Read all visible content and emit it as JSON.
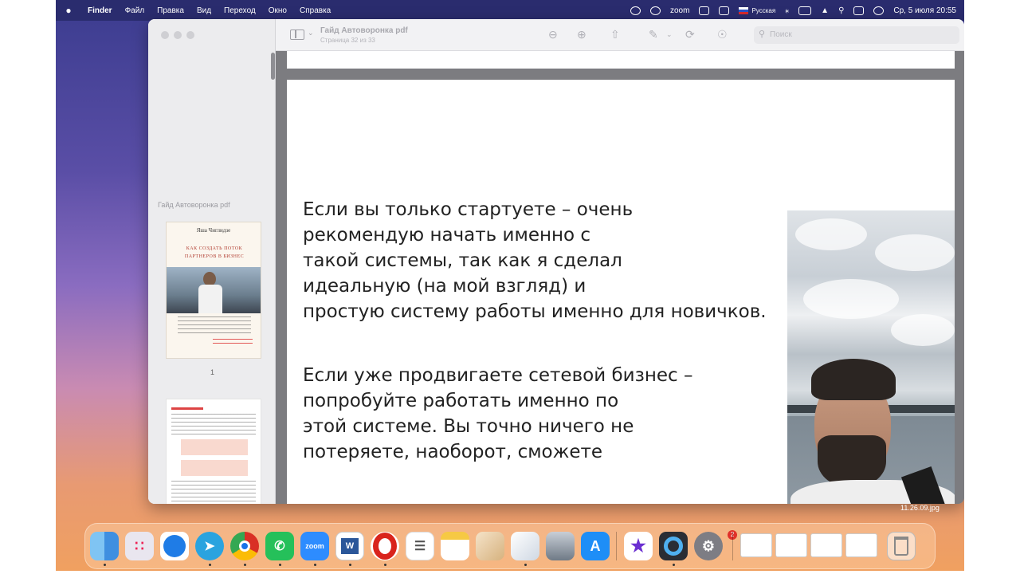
{
  "menubar": {
    "apple": "",
    "items": [
      "Finder",
      "Файл",
      "Правка",
      "Вид",
      "Переход",
      "Окно",
      "Справка"
    ],
    "zoom": "zoom",
    "language": "Русская",
    "clock": "Ср, 5 июля  20:55"
  },
  "sidebar": {
    "title": "Гайд Автоворонка pdf",
    "thumb1": {
      "author": "Яша Чиглидзе",
      "heading": "КАК СОЗДАТЬ ПОТОК ПАРТНЕРОВ В БИЗНЕС"
    },
    "page1_number": "1"
  },
  "toolbar": {
    "doc_title": "Гайд Автоворонка pdf",
    "doc_subtitle": "Страница 32 из 33",
    "search_placeholder": "Поиск"
  },
  "page": {
    "lines_a": [
      "Если вы только стартуете – очень",
      "рекомендую начать именно с",
      "такой системы, так как я сделал",
      "идеальную (на мой взгляд) и",
      "простую систему работы именно для новичков."
    ],
    "lines_b": [
      "Если уже продвигаете сетевой бизнес –",
      "попробуйте работать именно по",
      "этой системе. Вы точно ничего не",
      "потеряете, наоборот, сможете"
    ]
  },
  "screenshot_filename": "11.26.09.jpg",
  "dock": {
    "zoom_label": "zoom",
    "word_label": "W",
    "settings_badge": "2",
    "apps": [
      "finder-icon",
      "launchpad-icon",
      "safari-icon",
      "telegram-icon",
      "chrome-icon",
      "whatsapp-icon",
      "zoom-icon",
      "word-icon",
      "opera-icon",
      "reminders-icon",
      "notes-icon",
      "files-icon",
      "preview-icon",
      "image-capture-icon",
      "app-store-icon",
      "imovie-icon",
      "quicktime-icon",
      "system-settings-icon"
    ]
  },
  "colors": {
    "menubar": "#2a2c6e",
    "opera": "#d9241c",
    "telegram": "#2aa3df",
    "whatsapp": "#25c05a",
    "zoom": "#2d8cff"
  }
}
